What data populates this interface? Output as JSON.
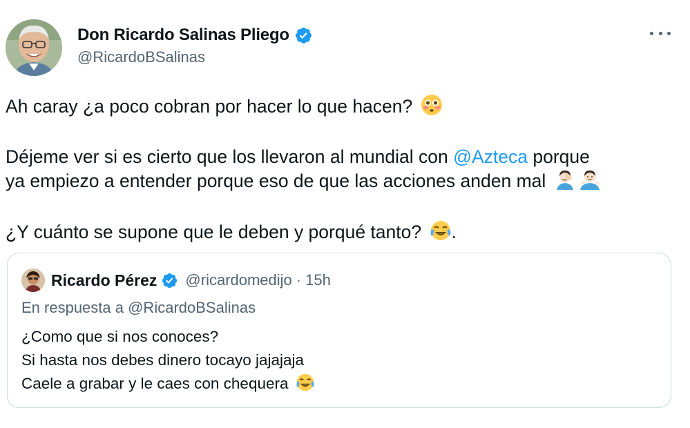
{
  "author": {
    "display_name": "Don Ricardo Salinas Pliego",
    "handle": "@RicardoBSalinas",
    "verified": true,
    "avatar_icon": "profile-photo"
  },
  "more_icon": "more-horizontal-icon",
  "tweet": {
    "line1": "Ah caray ¿a poco cobran por hacer lo que hacen?",
    "line1_emoji": "flushed-face-emoji",
    "line2_before": "Déjeme ver si es cierto que los llevaron al mundial con ",
    "line2_mention": "@Azteca",
    "line2_after": " porque",
    "line3": "ya empiezo a entender porque eso de que las acciones anden mal",
    "line3_emoji": "facepalm-emoji",
    "line3_emoji2": "shrug-emoji",
    "line4": "¿Y cuánto se supone que le deben y porqué tanto?",
    "line4_emoji": "tears-of-joy-emoji",
    "line4_end": "."
  },
  "quote": {
    "display_name": "Ricardo Pérez",
    "handle": "@ricardomedijo",
    "separator": "·",
    "time": "15h",
    "verified": true,
    "reply_to": "En respuesta a @RicardoBSalinas",
    "lines": [
      "¿Como que si nos conoces?",
      "Si hasta nos debes dinero tocayo jajajaja",
      "Caele a grabar y le caes con chequera"
    ],
    "last_emoji": "tears-of-joy-emoji"
  },
  "colors": {
    "link": "#1d9bf0",
    "secondary_text": "#536471",
    "border": "#cfd9de",
    "verified": "#1d9bf0"
  }
}
